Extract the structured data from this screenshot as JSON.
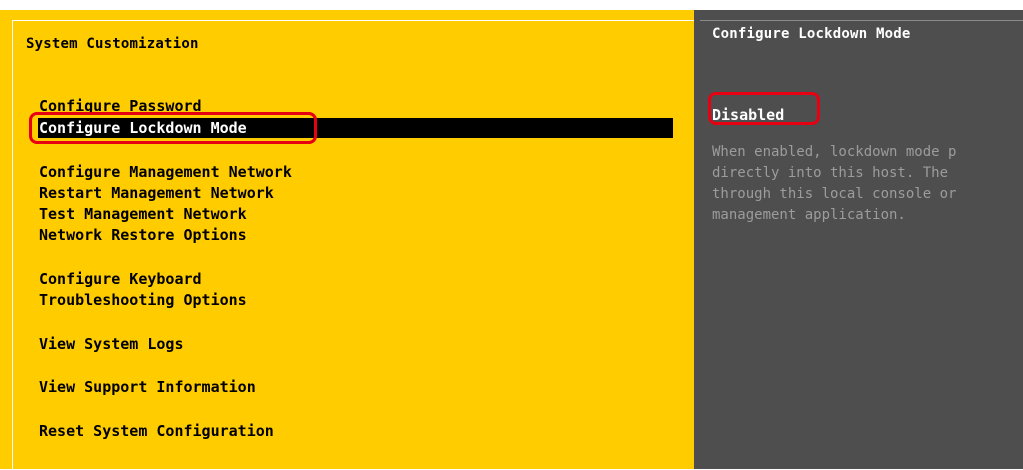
{
  "left_panel": {
    "title": "System Customization",
    "menu_items": [
      {
        "label": "Configure Password"
      },
      {
        "label": "Configure Lockdown Mode"
      },
      {
        "label": "Configure Management Network"
      },
      {
        "label": "Restart Management Network"
      },
      {
        "label": "Test Management Network"
      },
      {
        "label": "Network Restore Options"
      },
      {
        "label": "Configure Keyboard"
      },
      {
        "label": "Troubleshooting Options"
      },
      {
        "label": "View System Logs"
      },
      {
        "label": "View Support Information"
      },
      {
        "label": "Reset System Configuration"
      }
    ],
    "selected_item": "Configure Lockdown Mode"
  },
  "right_panel": {
    "title": "Configure Lockdown Mode",
    "status": "Disabled",
    "description": "When enabled, lockdown mode p\ndirectly into this host. The\nthrough this local console or\nmanagement application."
  },
  "colors": {
    "left_background": "#ffcc00",
    "right_background": "#4e4e4e",
    "selection_background": "#000000",
    "annotation_red": "#e60012",
    "description_text": "#9c9c9c"
  }
}
